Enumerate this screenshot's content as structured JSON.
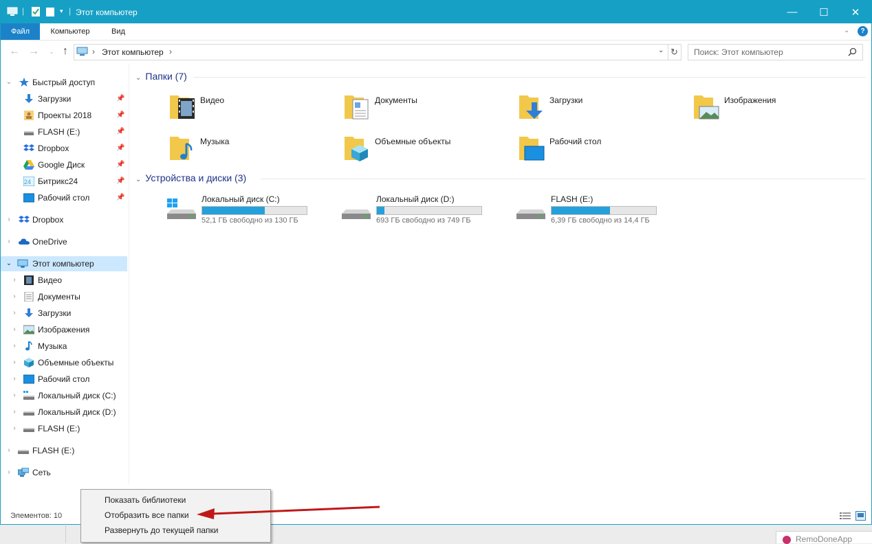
{
  "window": {
    "title": "Этот компьютер",
    "controls": {
      "minimize": "—",
      "maximize": "☐",
      "close": "✕"
    }
  },
  "ribbon": {
    "tabs": [
      "Файл",
      "Компьютер",
      "Вид"
    ],
    "help": "?"
  },
  "address": {
    "path": "Этот компьютер",
    "separator": "›",
    "search_placeholder": "Поиск: Этот компьютер"
  },
  "nav": {
    "quick_access": "Быстрый доступ",
    "quick_items": [
      "Загрузки",
      "Проекты 2018",
      "FLASH (E:)",
      "Dropbox",
      "Google Диск",
      "Битрикс24",
      "Рабочий стол"
    ],
    "roots_top": [
      "Dropbox",
      "OneDrive",
      "Этот компьютер"
    ],
    "computer_items": [
      "Видео",
      "Документы",
      "Загрузки",
      "Изображения",
      "Музыка",
      "Объемные объекты",
      "Рабочий стол",
      "Локальный диск (C:)",
      "Локальный диск (D:)",
      "FLASH (E:)"
    ],
    "roots_bottom": [
      "FLASH (E:)",
      "Сеть"
    ],
    "selected": "Этот компьютер"
  },
  "main": {
    "folders_header": "Папки (7)",
    "folders": [
      "Видео",
      "Документы",
      "Загрузки",
      "Изображения",
      "Музыка",
      "Объемные объекты",
      "Рабочий стол"
    ],
    "devices_header": "Устройства и диски (3)",
    "drives": [
      {
        "name": "Локальный диск (C:)",
        "free": "52,1 ГБ свободно из 130 ГБ",
        "used_fraction": 0.6
      },
      {
        "name": "Локальный диск (D:)",
        "free": "693 ГБ свободно из 749 ГБ",
        "used_fraction": 0.075
      },
      {
        "name": "FLASH (E:)",
        "free": "6,39 ГБ свободно из 14,4 ГБ",
        "used_fraction": 0.56
      }
    ]
  },
  "status": {
    "count": "Элементов: 10"
  },
  "context_menu": {
    "items": [
      "Показать библиотеки",
      "Отобразить все папки",
      "Развернуть до текущей папки"
    ]
  },
  "taskbar_chip": "RemoDoneApp",
  "colors": {
    "accent": "#17a0c5",
    "file_tab": "#1b82c9",
    "selection": "#cce8ff",
    "drive_bar": "#26a0da",
    "arrow": "#c01818"
  }
}
